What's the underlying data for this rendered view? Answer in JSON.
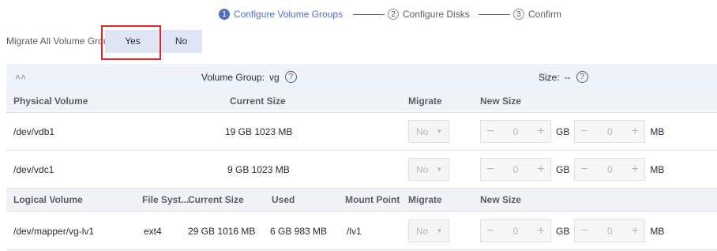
{
  "steps": [
    {
      "num": "1",
      "label": "Configure Volume Groups"
    },
    {
      "num": "2",
      "label": "Configure Disks"
    },
    {
      "num": "3",
      "label": "Confirm"
    }
  ],
  "migrate_all": {
    "label": "Migrate All Volume Groups",
    "yes": "Yes",
    "no": "No",
    "selected": "Yes"
  },
  "group": {
    "volume_group_label": "Volume Group:",
    "volume_group_value": "vg",
    "size_label": "Size:",
    "size_value": "--"
  },
  "pv_table": {
    "headers": {
      "physical_volume": "Physical Volume",
      "current_size": "Current Size",
      "migrate": "Migrate",
      "new_size": "New Size"
    },
    "rows": [
      {
        "name": "/dev/vdb1",
        "current_size": "19 GB 1023 MB",
        "migrate": "No",
        "gb": "0",
        "gb_unit": "GB",
        "mb": "0",
        "mb_unit": "MB"
      },
      {
        "name": "/dev/vdc1",
        "current_size": "9 GB 1023 MB",
        "migrate": "No",
        "gb": "0",
        "gb_unit": "GB",
        "mb": "0",
        "mb_unit": "MB"
      }
    ]
  },
  "lv_table": {
    "headers": {
      "logical_volume": "Logical Volume",
      "file_system": "File Syst...",
      "current_size": "Current Size",
      "used": "Used",
      "mount_point": "Mount Point",
      "migrate": "Migrate",
      "new_size": "New Size"
    },
    "rows": [
      {
        "name": "/dev/mapper/vg-lv1",
        "file_system": "ext4",
        "current_size": "29 GB 1016 MB",
        "used": "6 GB 983 MB",
        "mount_point": "/lv1",
        "migrate": "No",
        "gb": "0",
        "gb_unit": "GB",
        "mb": "0",
        "mb_unit": "MB"
      }
    ]
  },
  "icons": {
    "stepper_minus": "−",
    "stepper_plus": "+",
    "caret": "▼",
    "collapse": "≈",
    "help": "?"
  }
}
